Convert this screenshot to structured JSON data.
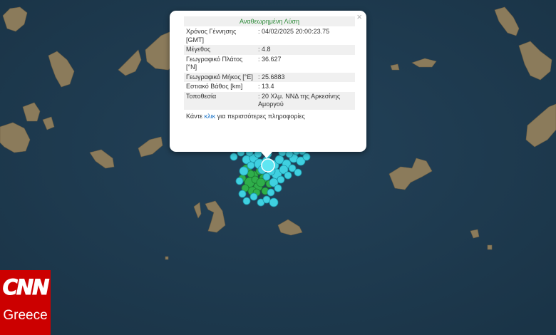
{
  "popup": {
    "title": "Αναθεωρημένη Λύση",
    "close_glyph": "×",
    "rows": [
      {
        "key": "Χρόνος Γέννησης [GMT]",
        "value": ": 04/02/2025 20:00:23.75"
      },
      {
        "key": "Μέγεθος",
        "value": ": 4.8"
      },
      {
        "key": "Γεωγραφικό Πλάτος [°N]",
        "value": ": 36.627"
      },
      {
        "key": "Γεωγραφικό Μήκος [°E]",
        "value": ": 25.6883"
      },
      {
        "key": "Εστιακό Βάθος [km]",
        "value": ": 13.4"
      },
      {
        "key": "Τοποθεσία",
        "value": ": 20 Χλμ. ΝΝΔ της Αρκεσίνης Αμοργού"
      }
    ],
    "more_before": "Κάντε ",
    "more_link": "κλικ",
    "more_after": " για περισσότερες πληροφορίες"
  },
  "watermark": {
    "logo_text": "CNN",
    "sub_text": "Greece",
    "color": "#cc0000"
  },
  "colors": {
    "sea": "#1d3a4f",
    "land": "#8a7a5a",
    "quake_recent": "#3fd0e0",
    "quake_older": "#2fae4a"
  }
}
